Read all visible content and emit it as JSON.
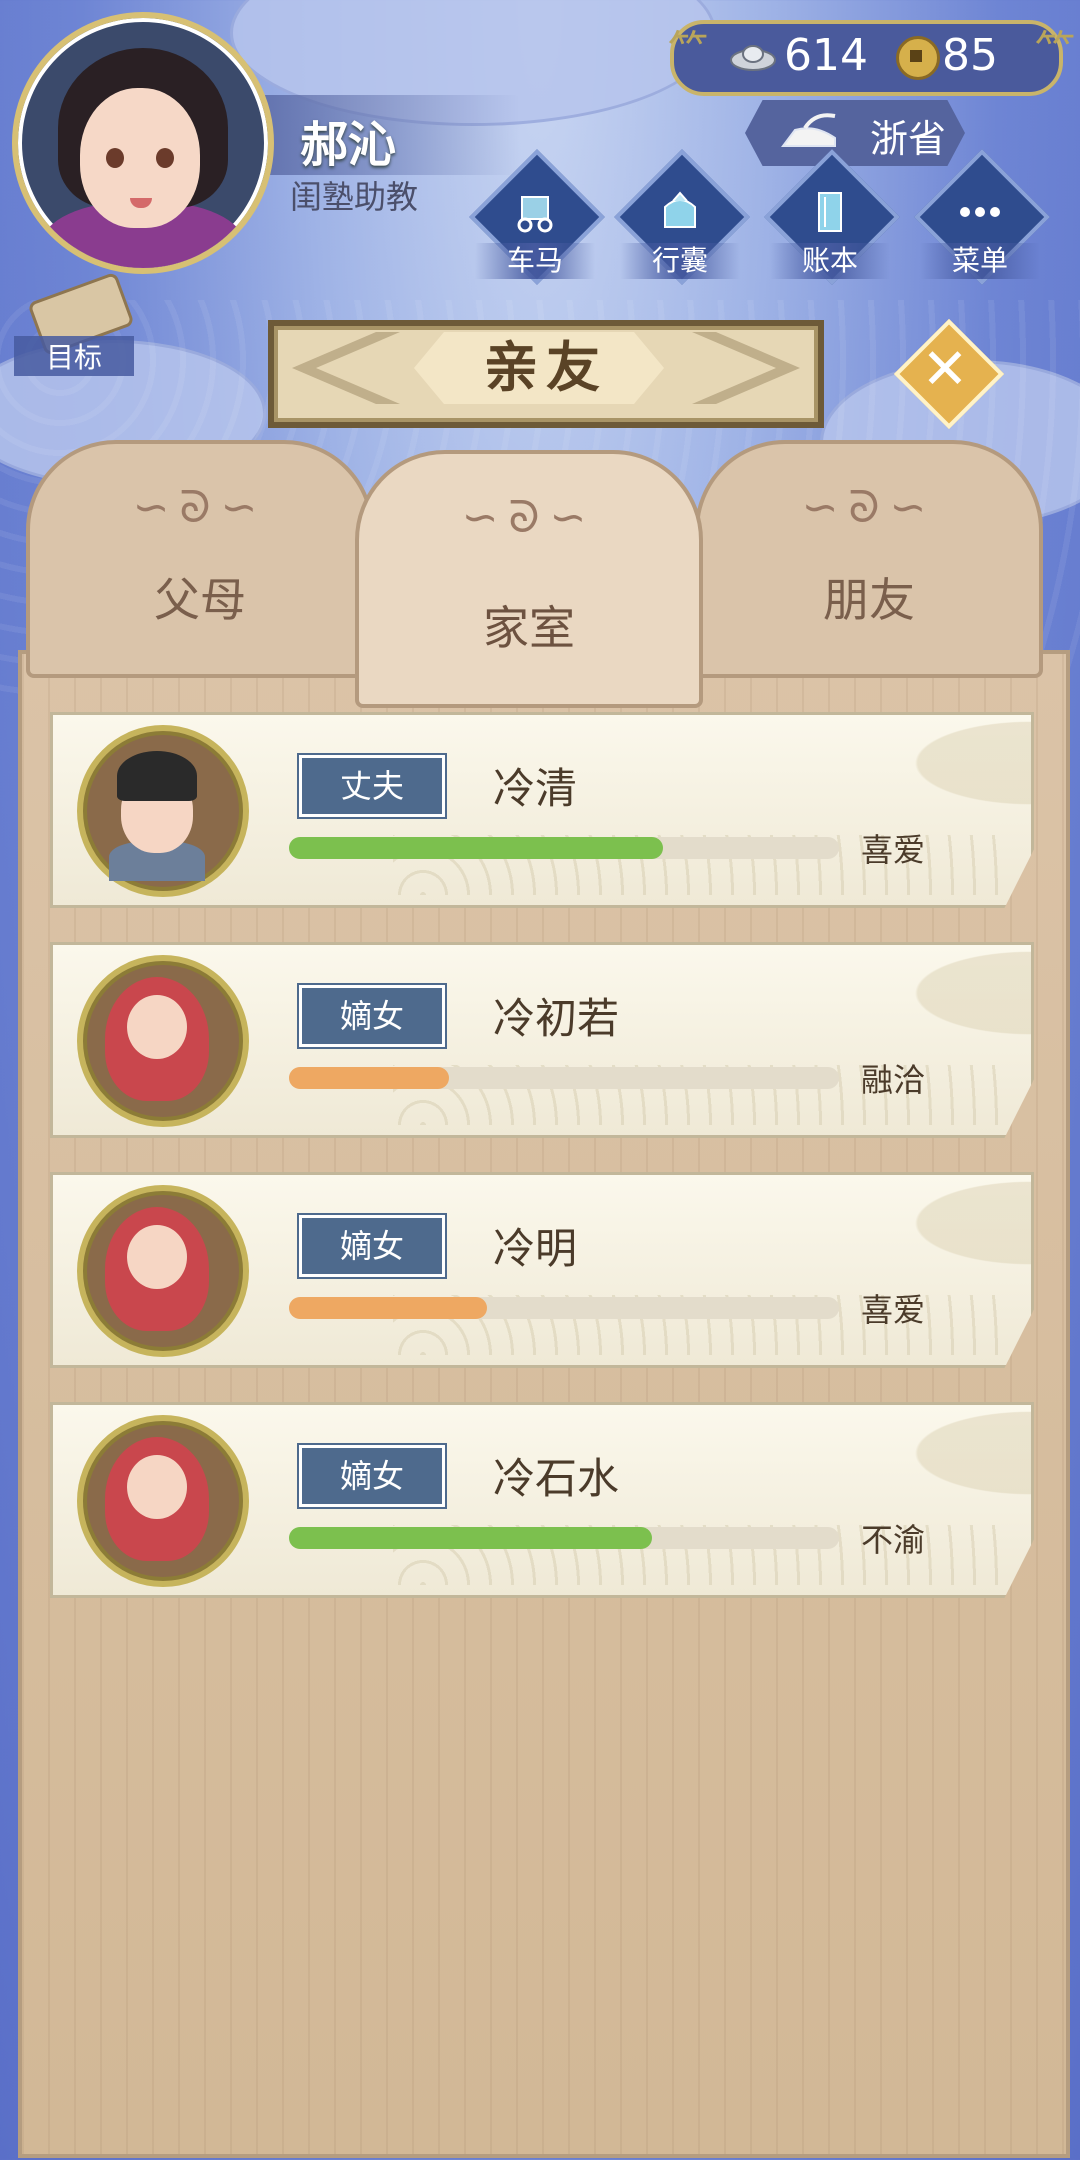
{
  "player": {
    "name": "郝沁",
    "title": "闺塾助教"
  },
  "currency": {
    "silver": "614",
    "copper": "85"
  },
  "province": "浙省",
  "nav": [
    {
      "label": "车马",
      "icon": "carriage-icon"
    },
    {
      "label": "行囊",
      "icon": "bag-icon"
    },
    {
      "label": "账本",
      "icon": "ledger-icon"
    },
    {
      "label": "菜单",
      "icon": "menu-dots-icon"
    }
  ],
  "goal_label": "目标",
  "page_title": "亲友",
  "tabs": [
    {
      "label": "父母",
      "active": false
    },
    {
      "label": "家室",
      "active": true
    },
    {
      "label": "朋友",
      "active": false
    }
  ],
  "relatives": [
    {
      "role": "丈夫",
      "name": "冷清",
      "mood": "喜爱",
      "affection": 0.68,
      "bar_color": "#7cc04e",
      "avatar": "man-avatar"
    },
    {
      "role": "嫡女",
      "name": "冷初若",
      "mood": "融洽",
      "affection": 0.29,
      "bar_color": "#eea862",
      "avatar": "baby-avatar"
    },
    {
      "role": "嫡女",
      "name": "冷明",
      "mood": "喜爱",
      "affection": 0.36,
      "bar_color": "#eea862",
      "avatar": "baby-avatar"
    },
    {
      "role": "嫡女",
      "name": "冷石水",
      "mood": "不渝",
      "affection": 0.66,
      "bar_color": "#7cc04e",
      "avatar": "baby-avatar"
    }
  ],
  "colors": {
    "sky": "#6e85d4",
    "tag_blue": "#4e6a8d",
    "board": "#d2b896",
    "gold": "#d7c074"
  }
}
